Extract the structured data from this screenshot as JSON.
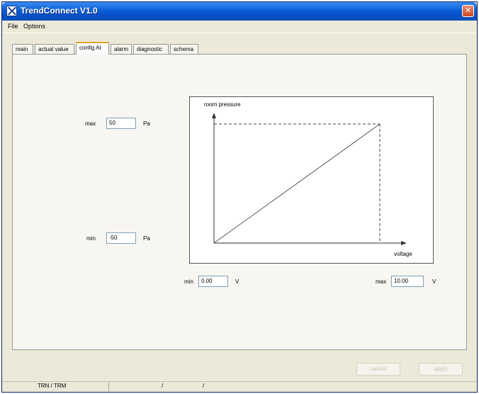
{
  "window": {
    "title": "TrendConnect V1.0"
  },
  "menu": [
    {
      "label": "File"
    },
    {
      "label": "Options"
    }
  ],
  "tabs": [
    {
      "label": "main"
    },
    {
      "label": "actual value"
    },
    {
      "label": "config AI"
    },
    {
      "label": "alarm"
    },
    {
      "label": "diagnostic"
    },
    {
      "label": "schema"
    }
  ],
  "config": {
    "max_label": "max",
    "max_value": "50",
    "max_unit": "Pa",
    "min_label": "min",
    "min_value": "-50",
    "min_unit": "Pa",
    "vmin_label": "min",
    "vmin_value": "0.00",
    "vmin_unit": "V",
    "vmax_label": "max",
    "vmax_value": "10.00",
    "vmax_unit": "V"
  },
  "graph": {
    "y_label": "room pressure",
    "x_label": "voltage"
  },
  "buttons": {
    "cancel": "cancel",
    "apply": "apply"
  },
  "status": {
    "text": "TRN / TRM",
    "sep1": "/",
    "sep2": "/"
  },
  "colors": {
    "title_bar": "#0a5fd8",
    "active_tab_accent": "#e6a429",
    "close_button": "#d24a22"
  }
}
